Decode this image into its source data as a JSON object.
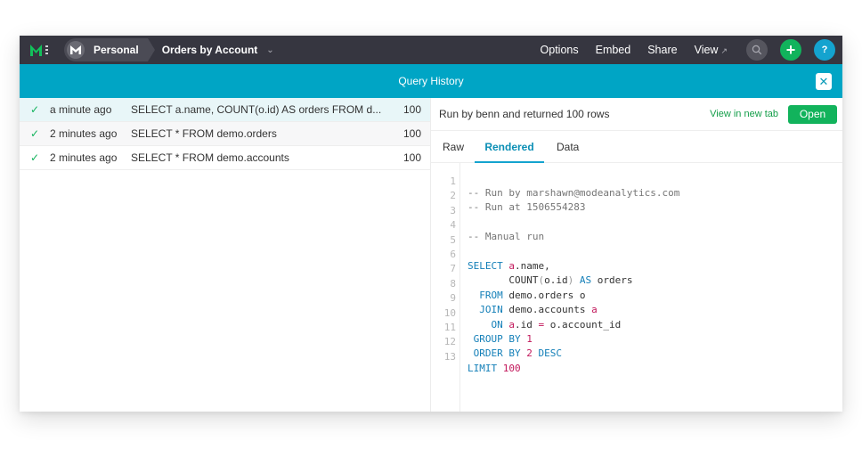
{
  "topbar": {
    "workspace": "Personal",
    "report_title": "Orders by Account",
    "nav": {
      "options": "Options",
      "embed": "Embed",
      "share": "Share",
      "view": "View",
      "view_ext": "↗"
    },
    "add_glyph": "+",
    "help_glyph": "?"
  },
  "query_history": {
    "title": "Query History",
    "close_glyph": "✕"
  },
  "history": [
    {
      "status": "✓",
      "time": "a minute ago",
      "sql": "SELECT a.name, COUNT(o.id) AS orders FROM d...",
      "count": "100"
    },
    {
      "status": "✓",
      "time": "2 minutes ago",
      "sql": "SELECT * FROM demo.orders",
      "count": "100"
    },
    {
      "status": "✓",
      "time": "2 minutes ago",
      "sql": "SELECT * FROM demo.accounts",
      "count": "100"
    }
  ],
  "detail": {
    "run_info": "Run by benn and returned 100 rows",
    "view_new_tab": "View in new tab",
    "open": "Open",
    "tabs": [
      "Raw",
      "Rendered",
      "Data"
    ],
    "active_tab": "Rendered"
  },
  "code": {
    "line_numbers": [
      "1",
      "2",
      "3",
      "4",
      "5",
      "6",
      "7",
      "8",
      "9",
      "10",
      "11",
      "12",
      "13"
    ],
    "lines": {
      "l1": "-- Run by marshawn@modeanalytics.com",
      "l2": "-- Run at 1506554283",
      "l4": "-- Manual run",
      "l6_kw": "SELECT",
      "l6_a": "a",
      "l6_rest": ".name,",
      "l7_fn": "COUNT",
      "l7_args": "o.id",
      "l7_as": "AS",
      "l7_alias": "orders",
      "l8_kw": "FROM",
      "l8_rest": "demo.orders o",
      "l9_kw": "JOIN",
      "l9_tbl": "demo.accounts",
      "l9_a": "a",
      "l10_kw": "ON",
      "l10_a": "a",
      "l10_mid": ".id",
      "l10_eq": "=",
      "l10_rest": "o.account_id",
      "l11_kw": "GROUP BY",
      "l11_n": "1",
      "l12_kw": "ORDER BY",
      "l12_n": "2",
      "l12_desc": "DESC",
      "l13_kw": "LIMIT",
      "l13_n": "100"
    }
  },
  "colors": {
    "topbar": "#363640",
    "accent_teal": "#00a5c5",
    "brand_green": "#12b35c",
    "help_blue": "#14a3cf"
  }
}
